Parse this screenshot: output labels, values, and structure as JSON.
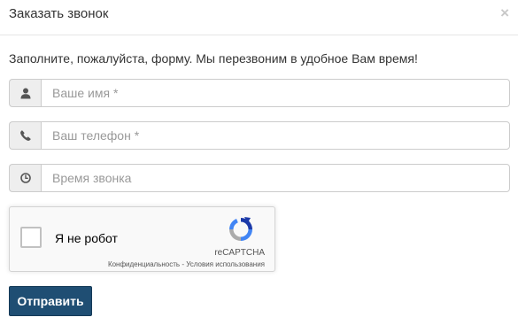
{
  "modal": {
    "title": "Заказать звонок",
    "close_label": "×"
  },
  "intro_text": "Заполните, пожалуйста, форму. Мы перезвоним в удобное Вам время!",
  "fields": [
    {
      "icon": "user-icon",
      "placeholder": "Ваше имя *",
      "value": ""
    },
    {
      "icon": "phone-icon",
      "placeholder": "Ваш телефон *",
      "value": ""
    },
    {
      "icon": "clock-icon",
      "placeholder": "Время звонка",
      "value": ""
    }
  ],
  "captcha": {
    "label": "Я не робот",
    "brand": "reCAPTCHA",
    "privacy_link": "Конфиденциальность",
    "separator": " - ",
    "terms_link": "Условия использования",
    "checked": false
  },
  "submit_label": "Отправить",
  "colors": {
    "primary_button": "#1f4e73",
    "addon_background": "#eeeeee",
    "border": "#cccccc"
  }
}
